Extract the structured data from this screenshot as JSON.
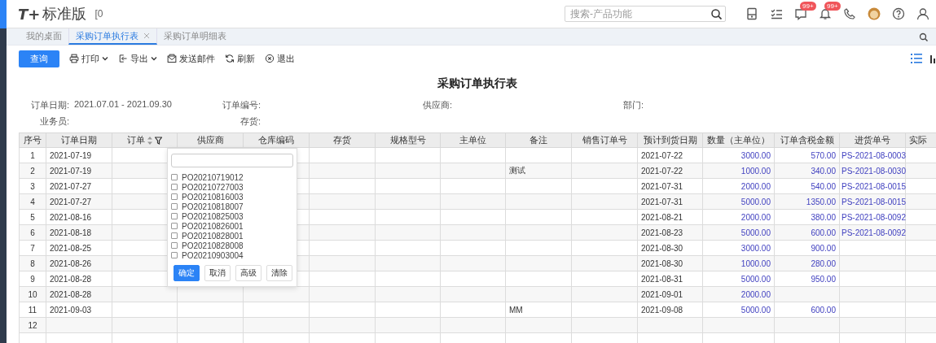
{
  "app": {
    "logo": "T+",
    "edition": "标准版",
    "account": "[0"
  },
  "search": {
    "placeholder": "搜索-产品功能"
  },
  "header_icons": [
    {
      "kind": "device"
    },
    {
      "kind": "tasks"
    },
    {
      "kind": "message",
      "badge": "99+"
    },
    {
      "kind": "bell",
      "badge": "99+"
    },
    {
      "kind": "phone"
    },
    {
      "kind": "avatar"
    },
    {
      "kind": "help"
    },
    {
      "kind": "user"
    }
  ],
  "tabs": [
    {
      "label": "我的桌面",
      "selected": false,
      "closable": false
    },
    {
      "label": "采购订单执行表",
      "selected": true,
      "closable": true
    },
    {
      "label": "采购订单明细表",
      "selected": false,
      "closable": false
    }
  ],
  "toolbar": {
    "primary": "查询",
    "items": [
      {
        "kind": "print",
        "label": "打印",
        "menu": true
      },
      {
        "kind": "export",
        "label": "导出",
        "menu": true
      },
      {
        "kind": "mail",
        "label": "发送邮件",
        "menu": false
      },
      {
        "kind": "refresh",
        "label": "刷新",
        "menu": false
      },
      {
        "kind": "exit",
        "label": "退出",
        "menu": false
      }
    ]
  },
  "report": {
    "title": "采购订单执行表",
    "filters": [
      {
        "label": "订单日期:",
        "value": "2021.07.01 - 2021.09.30"
      },
      {
        "label": "订单编号:"
      },
      {
        "label": "供应商:"
      },
      {
        "label": "部门:"
      },
      {
        "label": "业务员:"
      },
      {
        "label": "存货:"
      }
    ],
    "table": {
      "columns": [
        {
          "label": "序号"
        },
        {
          "label": "订单日期"
        },
        {
          "label": "订单",
          "sort": true,
          "filter": true
        },
        {
          "label": "供应商"
        },
        {
          "label": "仓库编码"
        },
        {
          "label": "存货"
        },
        {
          "label": "规格型号"
        },
        {
          "label": "主单位"
        },
        {
          "label": "备注"
        },
        {
          "label": "销售订单号"
        },
        {
          "label": "预计到货日期"
        },
        {
          "label": "数量（主单位）"
        },
        {
          "label": "订单含税金额"
        },
        {
          "label": "进货单号"
        },
        {
          "label": "实际"
        }
      ],
      "rows": [
        {
          "no": "1",
          "date": "2021-07-19",
          "due": "2021-07-22",
          "qty": "3000.00",
          "amount": "570.00",
          "receipt": "PS-2021-08-0003"
        },
        {
          "no": "2",
          "date": "2021-07-19",
          "remark": "测试",
          "due": "2021-07-22",
          "qty": "1000.00",
          "amount": "340.00",
          "receipt": "PS-2021-08-0030"
        },
        {
          "no": "3",
          "date": "2021-07-27",
          "due": "2021-07-31",
          "qty": "2000.00",
          "amount": "540.00",
          "receipt": "PS-2021-08-0015"
        },
        {
          "no": "4",
          "date": "2021-07-27",
          "due": "2021-07-31",
          "qty": "5000.00",
          "amount": "1350.00",
          "receipt": "PS-2021-08-0015"
        },
        {
          "no": "5",
          "date": "2021-08-16",
          "due": "2021-08-21",
          "qty": "2000.00",
          "amount": "380.00",
          "receipt": "PS-2021-08-0092"
        },
        {
          "no": "6",
          "date": "2021-08-18",
          "due": "2021-08-23",
          "qty": "5000.00",
          "amount": "600.00",
          "receipt": "PS-2021-08-0092"
        },
        {
          "no": "7",
          "date": "2021-08-25",
          "due": "2021-08-30",
          "qty": "3000.00",
          "amount": "900.00"
        },
        {
          "no": "8",
          "date": "2021-08-26",
          "due": "2021-08-30",
          "qty": "1000.00",
          "amount": "280.00"
        },
        {
          "no": "9",
          "date": "2021-08-28",
          "due": "2021-08-31",
          "qty": "5000.00",
          "amount": "950.00"
        },
        {
          "no": "10",
          "date": "2021-08-28",
          "due": "2021-09-01",
          "qty": "2000.00"
        },
        {
          "no": "11",
          "date": "2021-09-03",
          "remark": "MM",
          "due": "2021-09-08",
          "qty": "5000.00",
          "amount": "600.00"
        },
        {
          "no": "12"
        }
      ]
    },
    "filter_popup": {
      "options": [
        {
          "label": "PO20210719012",
          "checked": false
        },
        {
          "label": "PO20210727003",
          "checked": false
        },
        {
          "label": "PO20210816003",
          "checked": false
        },
        {
          "label": "PO20210818007",
          "checked": false
        },
        {
          "label": "PO20210825003",
          "checked": false
        },
        {
          "label": "PO20210826001",
          "checked": false
        },
        {
          "label": "PO20210828001",
          "checked": false
        },
        {
          "label": "PO20210828008",
          "checked": false
        },
        {
          "label": "PO20210903004",
          "checked": false
        }
      ],
      "buttons": [
        {
          "label": "确定",
          "primary": true
        },
        {
          "label": "取消",
          "primary": false
        },
        {
          "label": "高级",
          "primary": false
        },
        {
          "label": "清除",
          "primary": false
        }
      ]
    }
  }
}
